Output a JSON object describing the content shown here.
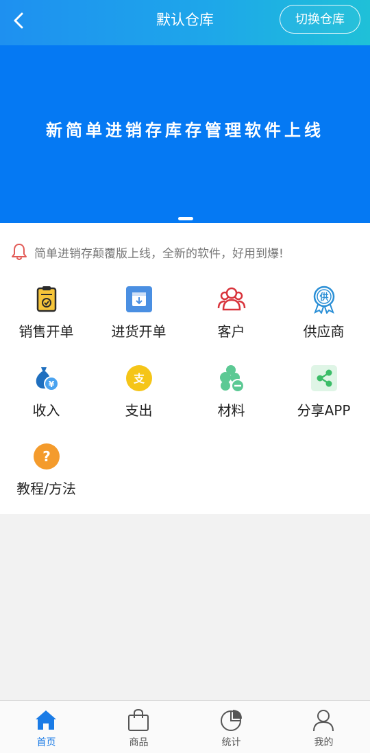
{
  "header": {
    "title": "默认仓库",
    "switch_label": "切换仓库"
  },
  "banner": {
    "text": "新简单进销存库存管理软件上线",
    "slides": 1,
    "active_slide": 1
  },
  "notice": {
    "text": "简单进销存颠覆版上线，全新的软件，好用到爆!"
  },
  "grid": [
    {
      "label": "销售开单",
      "icon": "sales-clipboard-icon"
    },
    {
      "label": "进货开单",
      "icon": "purchase-inbox-icon"
    },
    {
      "label": "客户",
      "icon": "customers-icon"
    },
    {
      "label": "供应商",
      "icon": "supplier-badge-icon"
    },
    {
      "label": "收入",
      "icon": "income-moneybag-icon"
    },
    {
      "label": "支出",
      "icon": "expense-coin-icon"
    },
    {
      "label": "材料",
      "icon": "materials-icon"
    },
    {
      "label": "分享APP",
      "icon": "share-icon"
    },
    {
      "label": "教程/方法",
      "icon": "help-icon"
    }
  ],
  "icon_glyphs": {
    "expense": "支",
    "supplier": "供",
    "income": "¥",
    "help": "?"
  },
  "tabs": [
    {
      "label": "首页",
      "icon": "home-icon",
      "active": true
    },
    {
      "label": "商品",
      "icon": "bag-icon",
      "active": false
    },
    {
      "label": "统计",
      "icon": "pie-chart-icon",
      "active": false
    },
    {
      "label": "我的",
      "icon": "user-icon",
      "active": false
    }
  ],
  "colors": {
    "header_gradient_start": "#1e90f0",
    "header_gradient_end": "#1fc0d8",
    "banner": "#0579f3",
    "active_tab": "#1a7be6"
  }
}
